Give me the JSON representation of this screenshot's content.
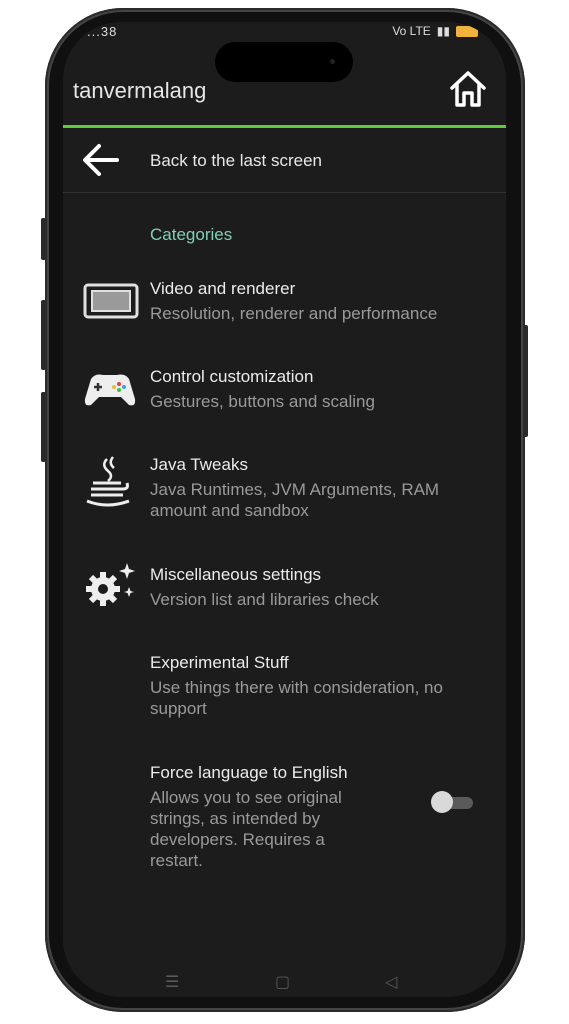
{
  "status_bar": {
    "time": "...38",
    "network": "Vo LTE"
  },
  "app": {
    "title": "tanvermalang"
  },
  "back": {
    "label": "Back to the last screen"
  },
  "section": {
    "title": "Categories"
  },
  "items": [
    {
      "title": "Video and renderer",
      "subtitle": "Resolution, renderer and performance",
      "icon": "display-icon"
    },
    {
      "title": "Control customization",
      "subtitle": "Gestures, buttons and scaling",
      "icon": "gamepad-icon"
    },
    {
      "title": "Java Tweaks",
      "subtitle": "Java Runtimes, JVM Arguments, RAM amount and sandbox",
      "icon": "java-icon"
    },
    {
      "title": "Miscellaneous settings",
      "subtitle": "Version list and libraries check",
      "icon": "gear-sparkle-icon"
    },
    {
      "title": "Experimental Stuff",
      "subtitle": "Use things there with consideration, no support",
      "icon": ""
    },
    {
      "title": "Force language to English",
      "subtitle": "Allows you to see original strings, as intended by developers. Requires a restart.",
      "icon": ""
    }
  ],
  "toggle": {
    "state": "off"
  },
  "colors": {
    "accent": "#5ecb3a",
    "category": "#7fd0b5",
    "background": "#1c1c1c"
  }
}
